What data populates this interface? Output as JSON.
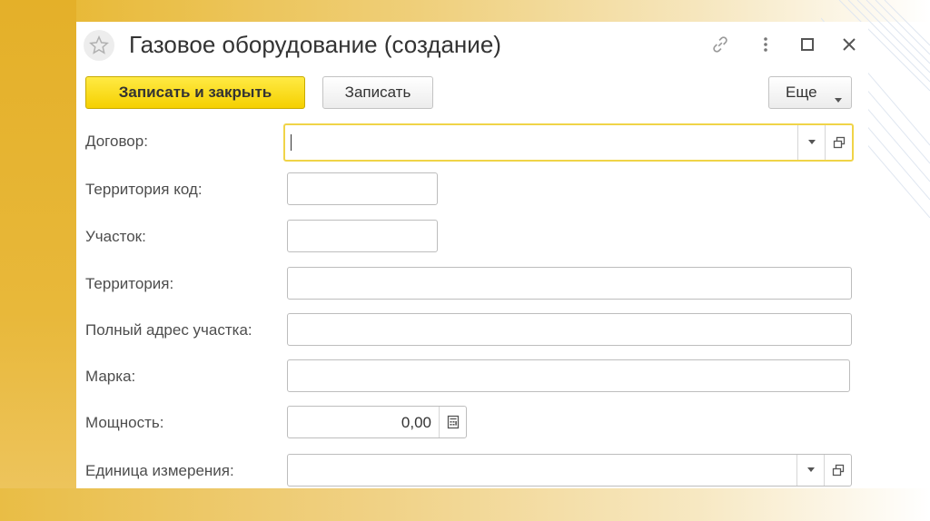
{
  "window": {
    "title": "Газовое оборудование (создание)",
    "icons": [
      "star-icon",
      "link-icon",
      "more-vertical-icon",
      "maximize-icon",
      "close-icon"
    ]
  },
  "toolbar": {
    "save_close_label": "Записать и закрыть",
    "save_label": "Записать",
    "more_label": "Еще"
  },
  "form": {
    "contract_label": "Договор:",
    "contract_value": "",
    "territory_code_label": "Территория код:",
    "territory_code_value": "",
    "plot_label": "Участок:",
    "plot_value": "",
    "territory_label": "Территория:",
    "territory_value": "",
    "full_address_label": "Полный адрес участка:",
    "full_address_value": "",
    "brand_label": "Марка:",
    "brand_value": "",
    "power_label": "Мощность:",
    "power_value": "0,00",
    "unit_label": "Единица измерения:",
    "unit_value": ""
  },
  "colors": {
    "accent": "#f5d000",
    "focus_border": "#f0d448",
    "slide_gold": "#e4b029"
  }
}
